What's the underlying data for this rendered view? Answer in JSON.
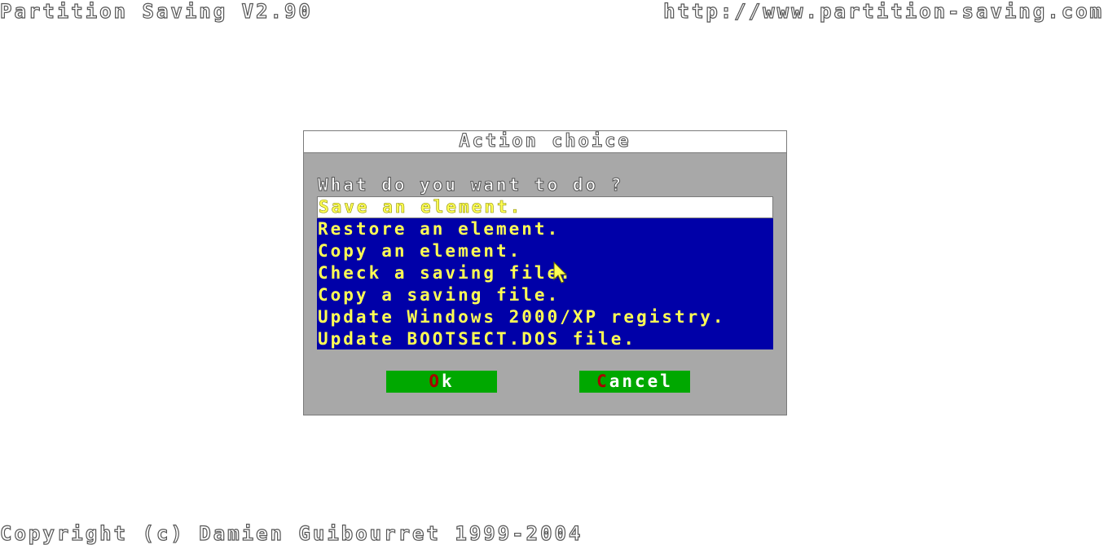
{
  "header": {
    "title": "Partition Saving V2.90",
    "url": "http://www.partition-saving.com"
  },
  "dialog": {
    "title": "Action choice",
    "prompt": "What do you want to do ?",
    "items": [
      {
        "label": "Save an element.",
        "selected": true
      },
      {
        "label": "Restore an element.",
        "selected": false
      },
      {
        "label": "Copy an element.",
        "selected": false
      },
      {
        "label": "Check a saving file.",
        "selected": false
      },
      {
        "label": "Copy a saving file.",
        "selected": false
      },
      {
        "label": "Update Windows 2000/XP registry.",
        "selected": false
      },
      {
        "label": "Update BOOTSECT.DOS file.",
        "selected": false
      }
    ],
    "ok_button": {
      "hotkey": "O",
      "rest": "k"
    },
    "cancel_button": {
      "hotkey": "C",
      "rest": "ancel"
    }
  },
  "footer": {
    "copyright": "Copyright (c) Damien Guibourret 1999-2004"
  },
  "colors": {
    "list_background": "#0000a8",
    "item_text": "#ffff54",
    "dialog_background": "#a8a8a8",
    "button_background": "#00a800",
    "hotkey": "#a80000"
  },
  "icons": {
    "cursor": "mouse-pointer-icon"
  }
}
